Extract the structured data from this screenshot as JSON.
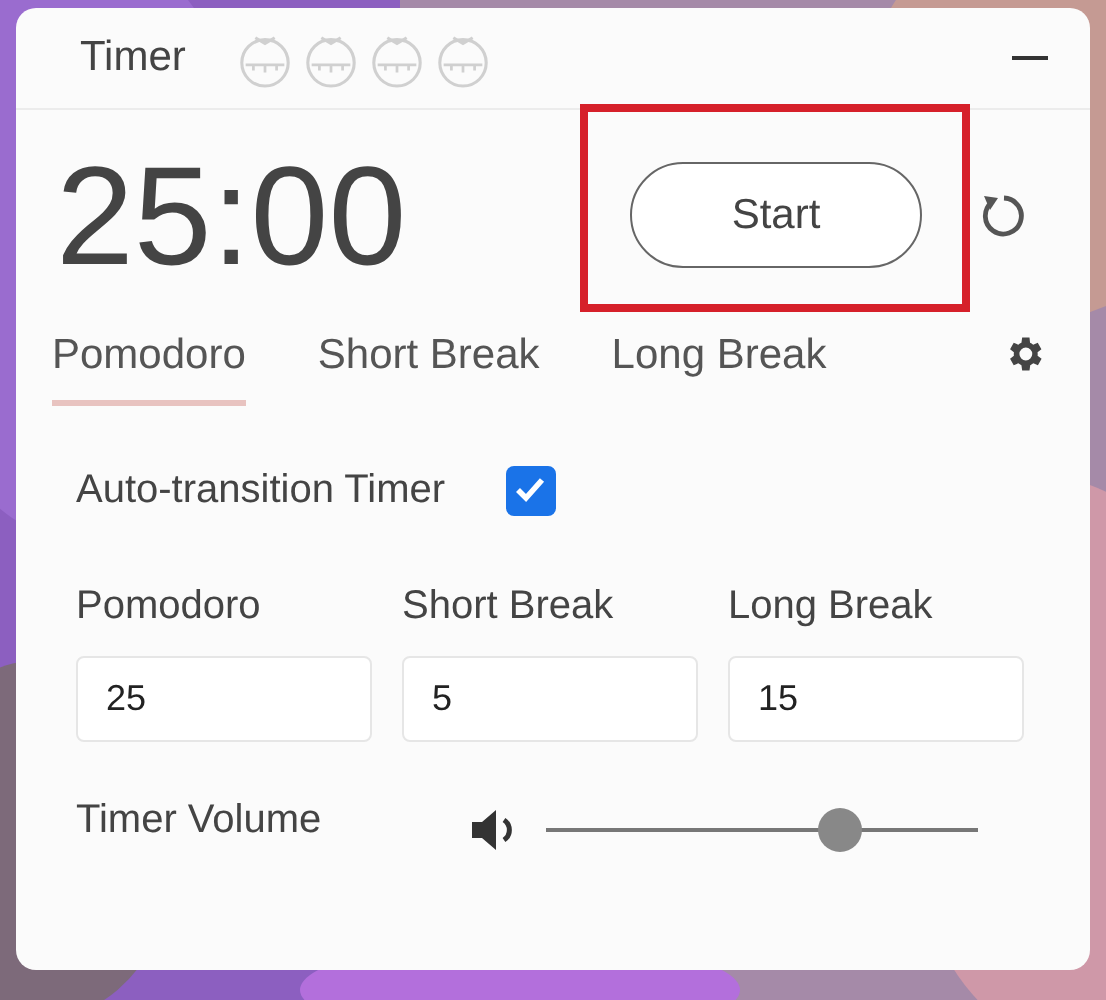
{
  "window": {
    "title": "Timer"
  },
  "pomodoros": [
    {
      "done": false
    },
    {
      "done": false
    },
    {
      "done": false
    },
    {
      "done": false
    }
  ],
  "timer": {
    "display": "25:00"
  },
  "start_button": {
    "label": "Start",
    "highlighted": true
  },
  "tabs": [
    {
      "label": "Pomodoro",
      "selected": true
    },
    {
      "label": "Short Break",
      "selected": false
    },
    {
      "label": "Long Break",
      "selected": false
    }
  ],
  "auto_transition": {
    "label": "Auto-transition Timer",
    "checked": true
  },
  "durations": [
    {
      "label": "Pomodoro",
      "value": "25"
    },
    {
      "label": "Short Break",
      "value": "5"
    },
    {
      "label": "Long Break",
      "value": "15"
    }
  ],
  "volume": {
    "label": "Timer Volume",
    "level": 0.68
  }
}
